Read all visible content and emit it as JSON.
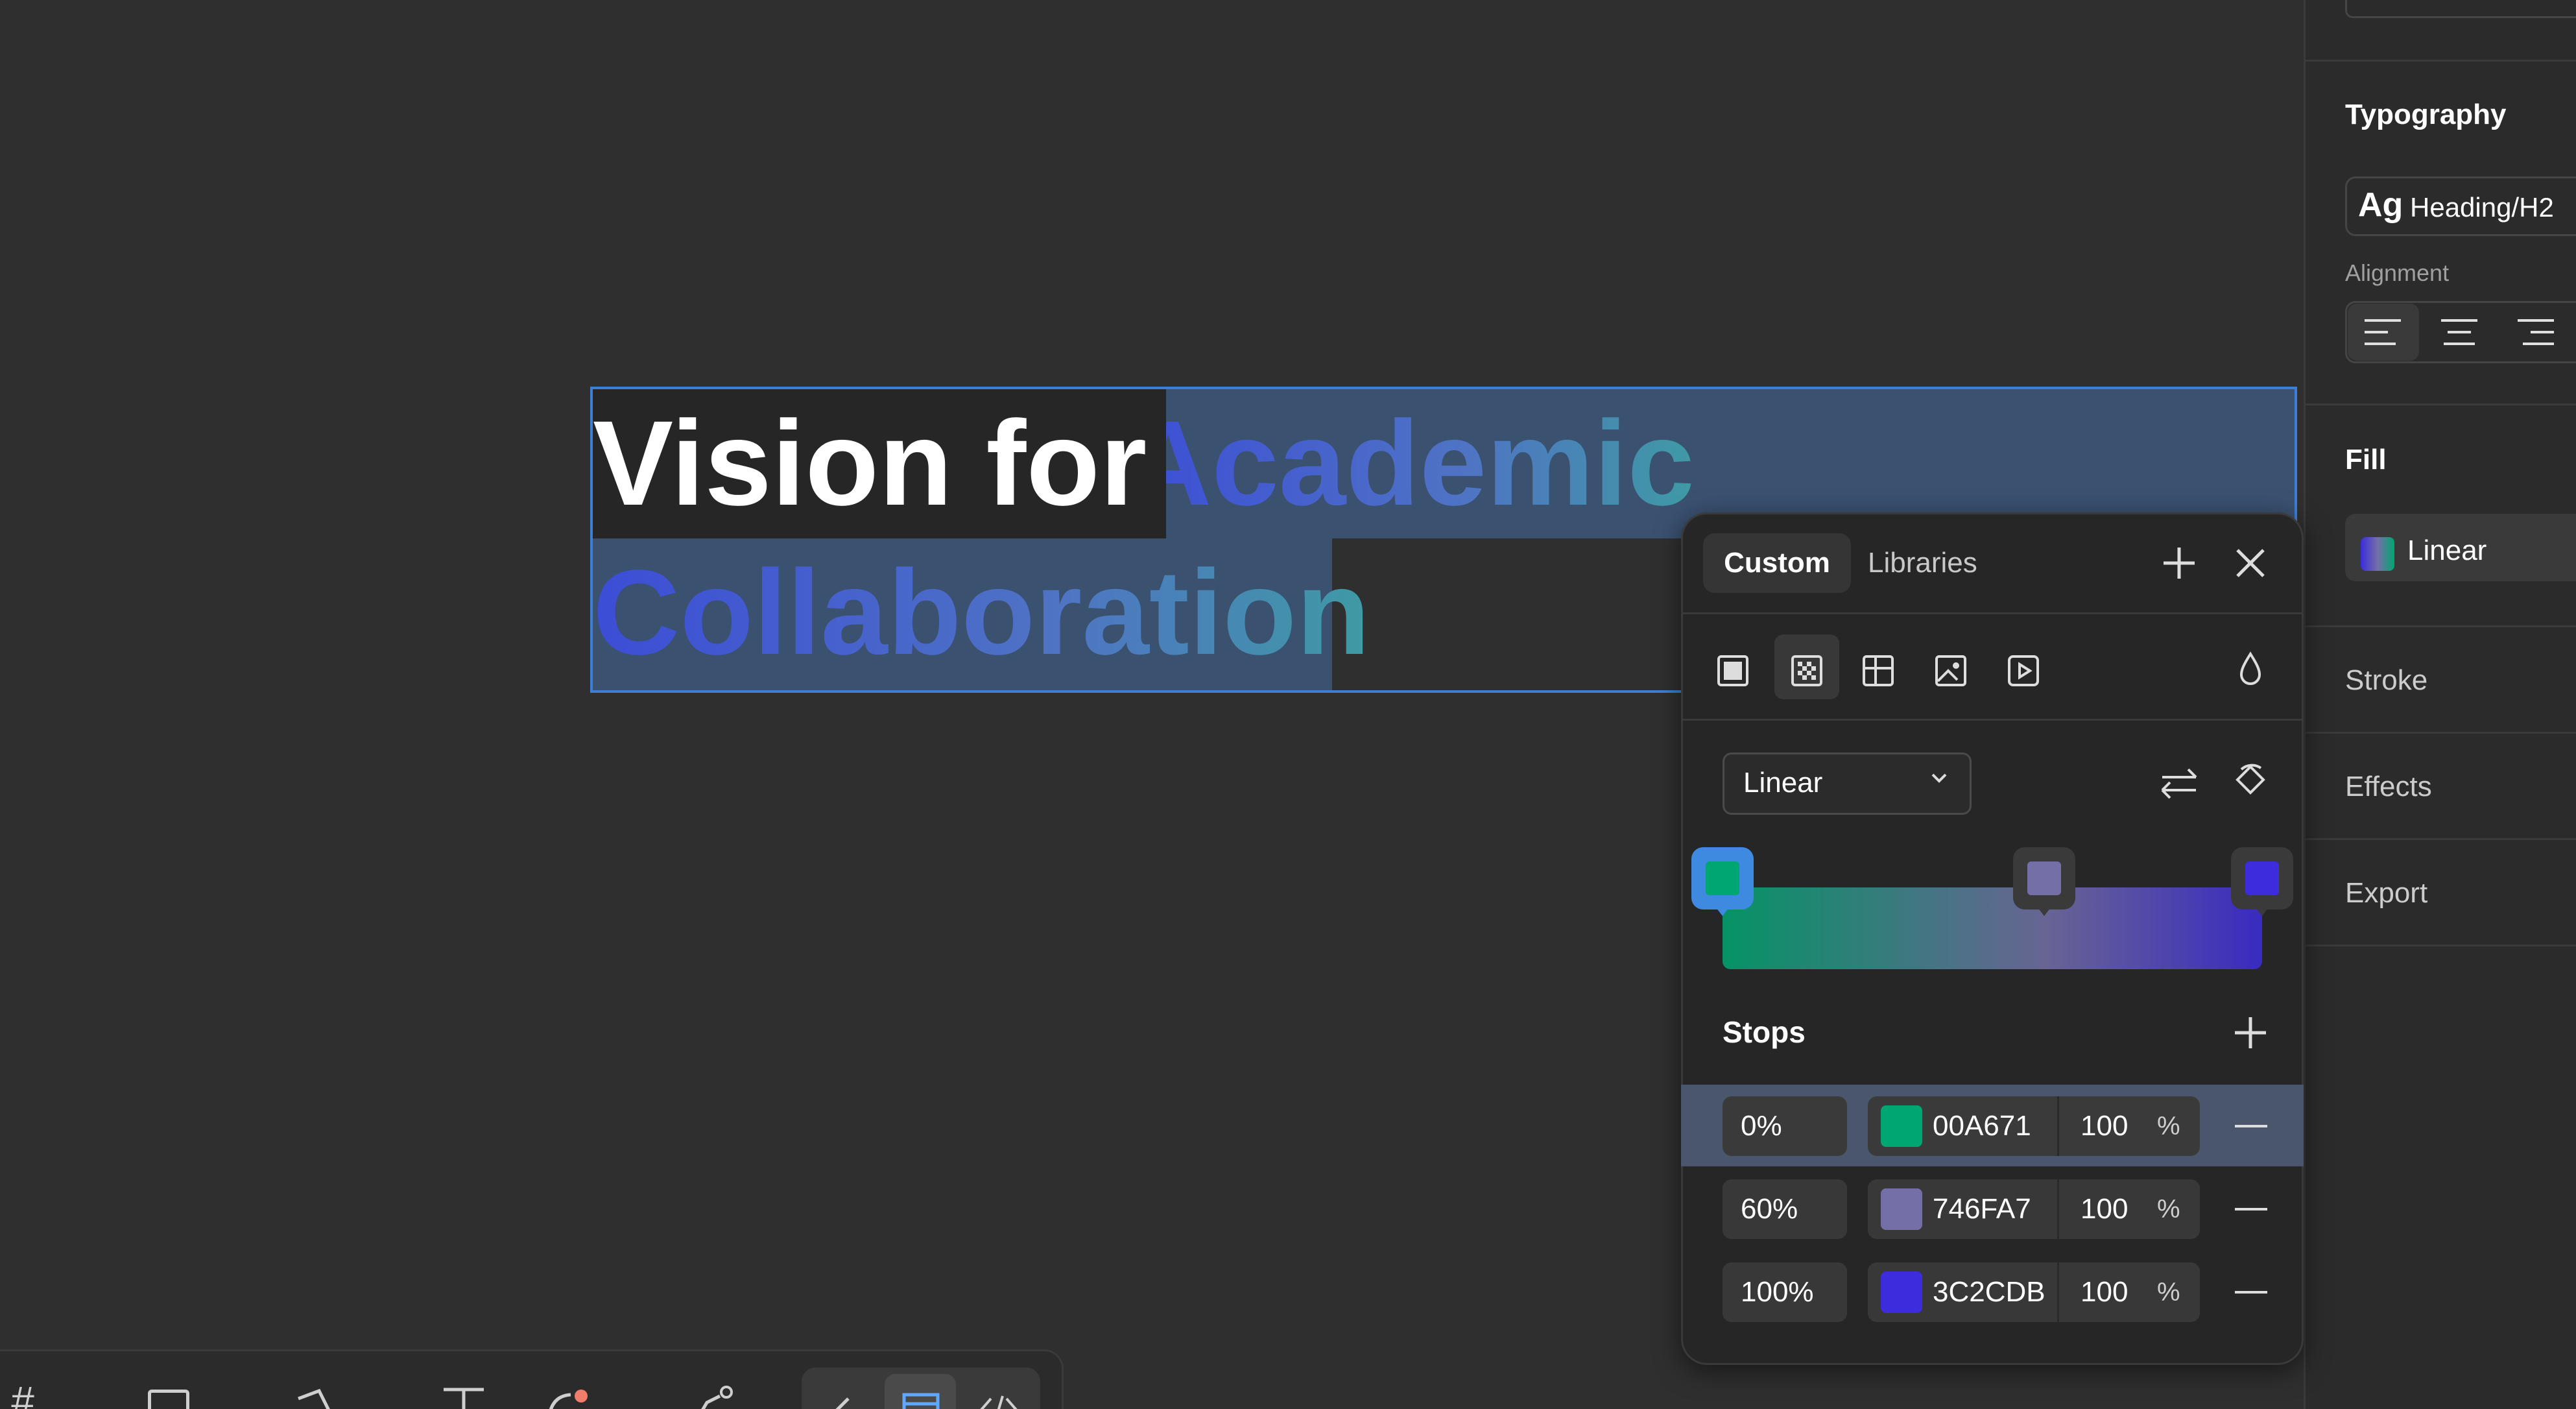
{
  "canvas": {
    "heading_plain": "Vision for ",
    "heading_grad_1": "Academic",
    "heading_grad_2": "Collaboration"
  },
  "right_panel": {
    "typography_title": "Typography",
    "font_ag": "Ag",
    "font_name": "Heading/H2",
    "alignment_label": "Alignment",
    "fill_title": "Fill",
    "fill_value": "Linear",
    "stroke_title": "Stroke",
    "effects_title": "Effects",
    "export_title": "Export"
  },
  "picker": {
    "tab_custom": "Custom",
    "tab_libraries": "Libraries",
    "gradient_type": "Linear",
    "stops_label": "Stops",
    "stops": [
      {
        "position": "0%",
        "hex": "00A671",
        "opacity": "100",
        "unit": "%",
        "color": "#00A671"
      },
      {
        "position": "60%",
        "hex": "746FA7",
        "opacity": "100",
        "unit": "%",
        "color": "#746FA7"
      },
      {
        "position": "100%",
        "hex": "3C2CDB",
        "opacity": "100",
        "unit": "%",
        "color": "#3C2CDB"
      }
    ]
  },
  "colors": {
    "selection": "#3d7fd6",
    "accent": "#3d8ae0"
  }
}
